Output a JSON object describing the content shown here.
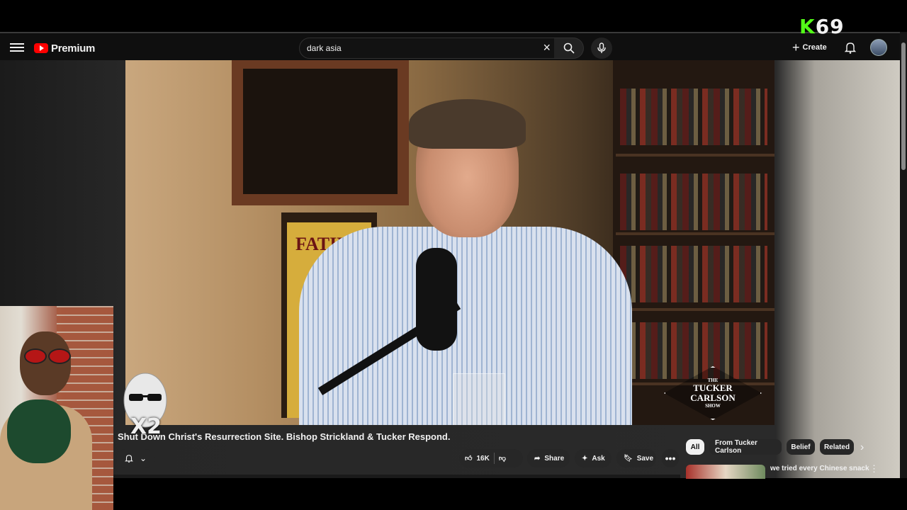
{
  "header": {
    "logo_text": "Premium",
    "search_value": "dark asia",
    "create_label": "Create"
  },
  "overlay": {
    "k69_k": "K",
    "k69_num": "69",
    "multiplier": "X2"
  },
  "video": {
    "logo_small_top": "THE",
    "logo_line1": "TUCKER",
    "logo_line2": "CARLSON",
    "logo_small_bottom": "SHOW",
    "poster_text": "FATIMA",
    "title": "Shut Down Christ's Resurrection Site. Bishop Strickland & Tucker Respond."
  },
  "actions": {
    "likes": "16K",
    "share": "Share",
    "ask": "Ask",
    "save": "Save"
  },
  "chips": [
    "All",
    "From Tucker Carlson",
    "Belief",
    "Related"
  ],
  "recommendation": {
    "title": "we tried every Chinese snack"
  },
  "colors": {
    "brand_red": "#ff0000",
    "kick_green": "#53fc18",
    "background": "#0f0f0f"
  }
}
